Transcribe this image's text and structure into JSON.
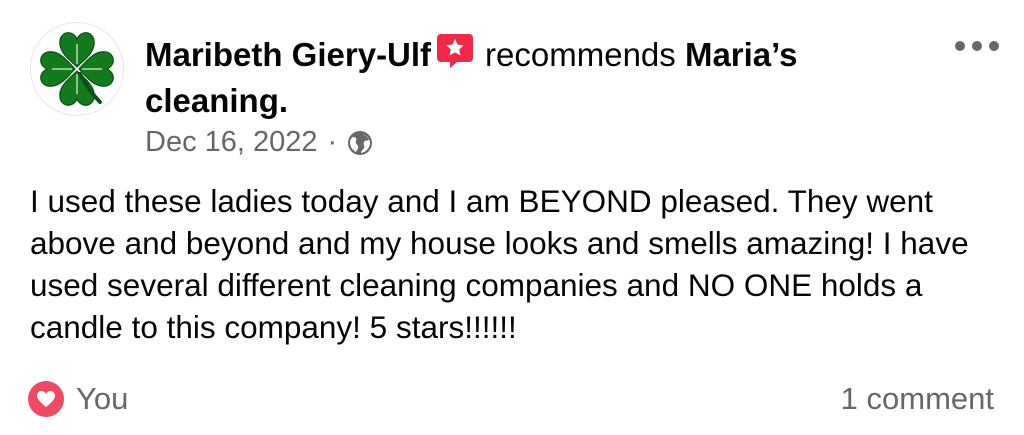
{
  "post": {
    "author_name": "Maribeth Giery-Ulf",
    "action_text": "recommends",
    "page_name": "Maria’s cleaning.",
    "date": "Dec 16, 2022",
    "separator": "·",
    "privacy_icon": "globe-icon",
    "avatar_icon": "four-leaf-clover-icon",
    "badge_icon": "recommendation-star-icon",
    "body": "I used these ladies today and I am BEYOND pleased. They went above and beyond and my house looks and smells amazing! I have used several different cleaning companies and NO ONE holds a candle to this company! 5 stars!!!!!!"
  },
  "footer": {
    "reaction_icon": "love-reaction-icon",
    "reaction_label": "You",
    "comments_label": "1 comment"
  },
  "colors": {
    "clover_green": "#137a1e",
    "badge_pink": "#f02849",
    "love_red": "#ef4a63",
    "secondary_text": "#65676b"
  }
}
